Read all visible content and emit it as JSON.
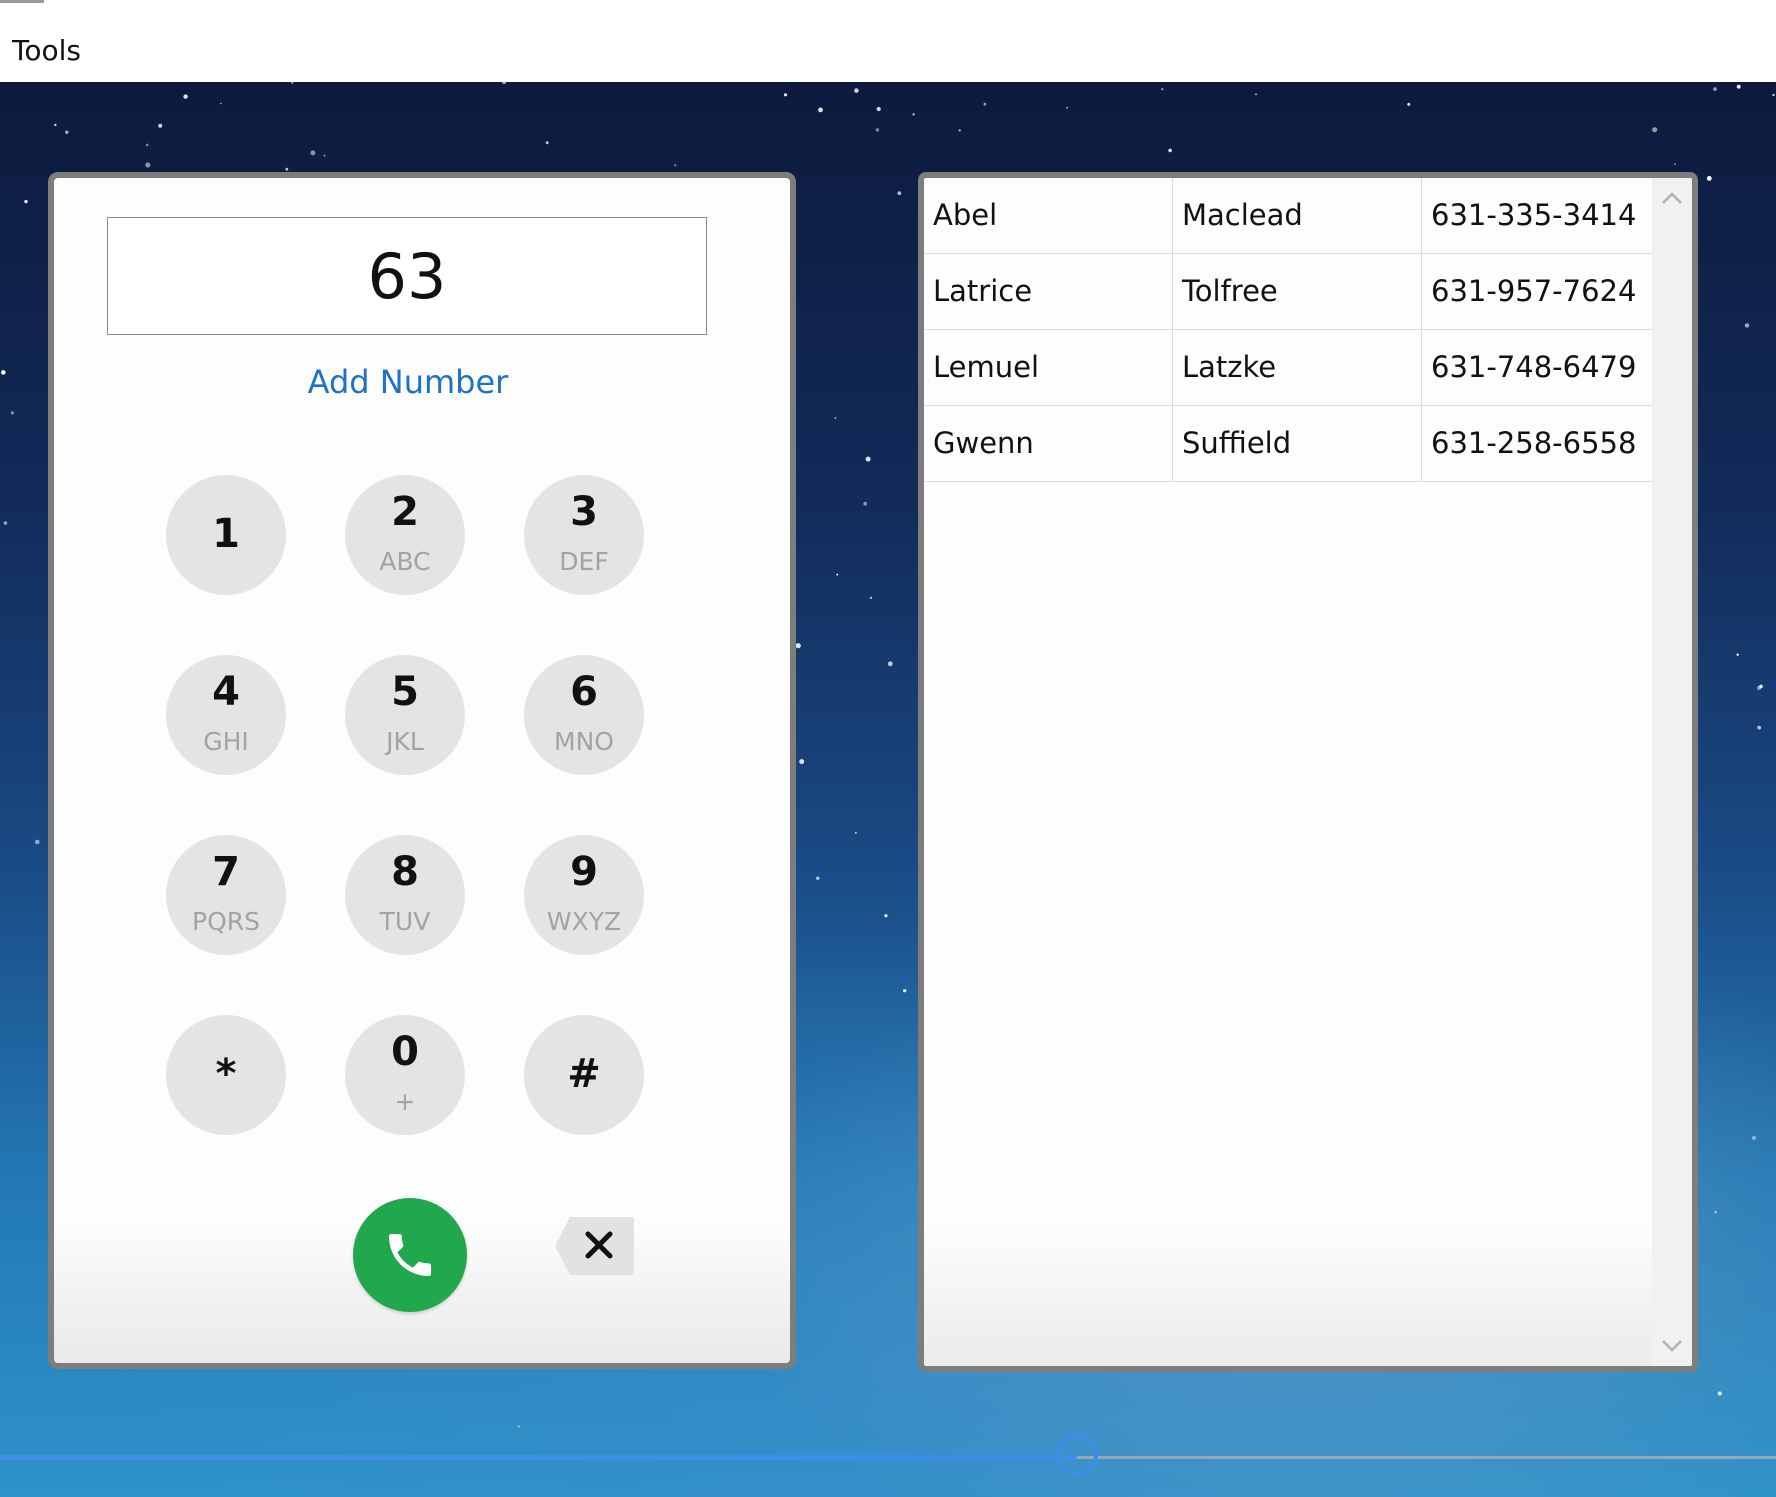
{
  "menu": {
    "items": [
      {
        "label": "Tools"
      }
    ]
  },
  "dialer": {
    "display_value": "63",
    "add_number_label": "Add Number",
    "keys": [
      {
        "digit": "1",
        "letters": ""
      },
      {
        "digit": "2",
        "letters": "ABC"
      },
      {
        "digit": "3",
        "letters": "DEF"
      },
      {
        "digit": "4",
        "letters": "GHI"
      },
      {
        "digit": "5",
        "letters": "JKL"
      },
      {
        "digit": "6",
        "letters": "MNO"
      },
      {
        "digit": "7",
        "letters": "PQRS"
      },
      {
        "digit": "8",
        "letters": "TUV"
      },
      {
        "digit": "9",
        "letters": "WXYZ"
      },
      {
        "digit": "*",
        "letters": ""
      },
      {
        "digit": "0",
        "letters": "+"
      },
      {
        "digit": "#",
        "letters": ""
      }
    ],
    "call_icon": "phone-icon",
    "backspace_icon": "backspace-icon",
    "call_color": "#21a74c"
  },
  "contacts": {
    "rows": [
      {
        "first": "Abel",
        "last": "Maclead",
        "phone": "631-335-3414"
      },
      {
        "first": "Latrice",
        "last": "Tolfree",
        "phone": "631-957-7624"
      },
      {
        "first": "Lemuel",
        "last": "Latzke",
        "phone": "631-748-6479"
      },
      {
        "first": "Gwenn",
        "last": "Suffield",
        "phone": "631-258-6558"
      }
    ]
  },
  "slider": {
    "value_fraction": 0.61,
    "accent": "#3d8ee8"
  },
  "colors": {
    "link": "#1c72c8",
    "key_bg": "#e4e4e4"
  }
}
